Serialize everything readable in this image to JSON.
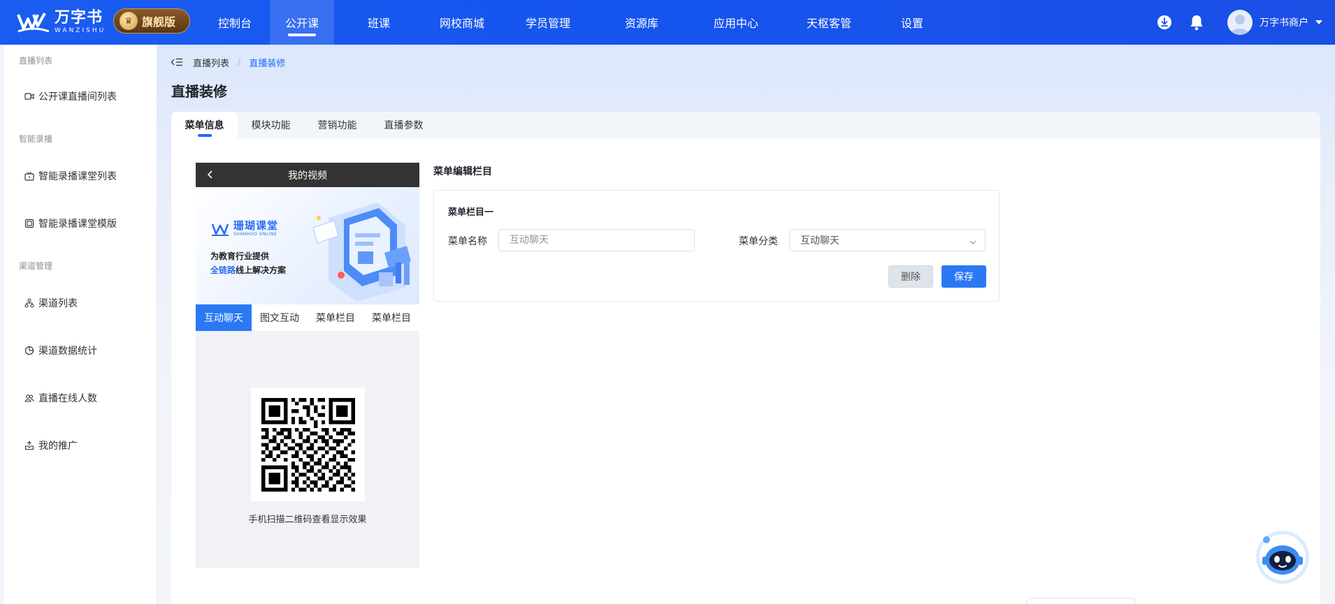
{
  "brand": {
    "name_cn": "万字书",
    "name_en": "WANZISHU",
    "edition": "旗舰版"
  },
  "nav": {
    "items": [
      {
        "label": "控制台"
      },
      {
        "label": "公开课"
      },
      {
        "label": "班课"
      },
      {
        "label": "网校商城"
      },
      {
        "label": "学员管理"
      },
      {
        "label": "资源库"
      },
      {
        "label": "应用中心"
      },
      {
        "label": "天枢客管"
      },
      {
        "label": "设置"
      }
    ],
    "active": "公开课"
  },
  "user": {
    "name": "万字书商户"
  },
  "sidebar": {
    "groups": [
      {
        "title": "直播列表",
        "items": [
          {
            "label": "公开课直播间列表",
            "icon": "video-camera-icon"
          }
        ]
      },
      {
        "title": "智能录播",
        "items": [
          {
            "label": "智能录播课堂列表",
            "icon": "tv-icon"
          },
          {
            "label": "智能录播课堂模版",
            "icon": "template-icon"
          }
        ]
      },
      {
        "title": "渠道管理",
        "items": [
          {
            "label": "渠道列表",
            "icon": "network-icon"
          },
          {
            "label": "渠道数据统计",
            "icon": "pie-chart-icon"
          },
          {
            "label": "直播在线人数",
            "icon": "users-icon"
          },
          {
            "label": "我的推广",
            "icon": "promotion-icon"
          }
        ]
      }
    ]
  },
  "breadcrumb": {
    "items": [
      {
        "label": "直播列表"
      },
      {
        "label": "直播装修"
      }
    ],
    "separator": "/"
  },
  "page": {
    "title": "直播装修"
  },
  "tabs": [
    {
      "label": "菜单信息",
      "active": true
    },
    {
      "label": "模块功能",
      "active": false
    },
    {
      "label": "营销功能",
      "active": false
    },
    {
      "label": "直播参数",
      "active": false
    }
  ],
  "preview": {
    "header_title": "我的视频",
    "banner": {
      "brand_cn": "珊瑚课堂",
      "brand_en": "SHANHOO ONLINE",
      "line1": "为教育行业提供",
      "line2_highlight": "全链路",
      "line2_rest": "线上解决方案"
    },
    "tabs": [
      {
        "label": "互动聊天",
        "active": true
      },
      {
        "label": "图文互动",
        "active": false
      },
      {
        "label": "菜单栏目",
        "active": false
      },
      {
        "label": "菜单栏目",
        "active": false
      }
    ],
    "qr_hint": "手机扫描二维码查看显示效果"
  },
  "editor": {
    "section_title": "菜单编辑栏目",
    "menu": {
      "title": "菜单栏目一",
      "name_label": "菜单名称",
      "name_placeholder": "互动聊天",
      "category_label": "菜单分类",
      "category_value": "互动聊天",
      "delete_label": "删除",
      "save_label": "保存"
    }
  },
  "colors": {
    "primary": "#2b78f5",
    "topbar": "#1654ee",
    "link": "#1e6bff"
  }
}
